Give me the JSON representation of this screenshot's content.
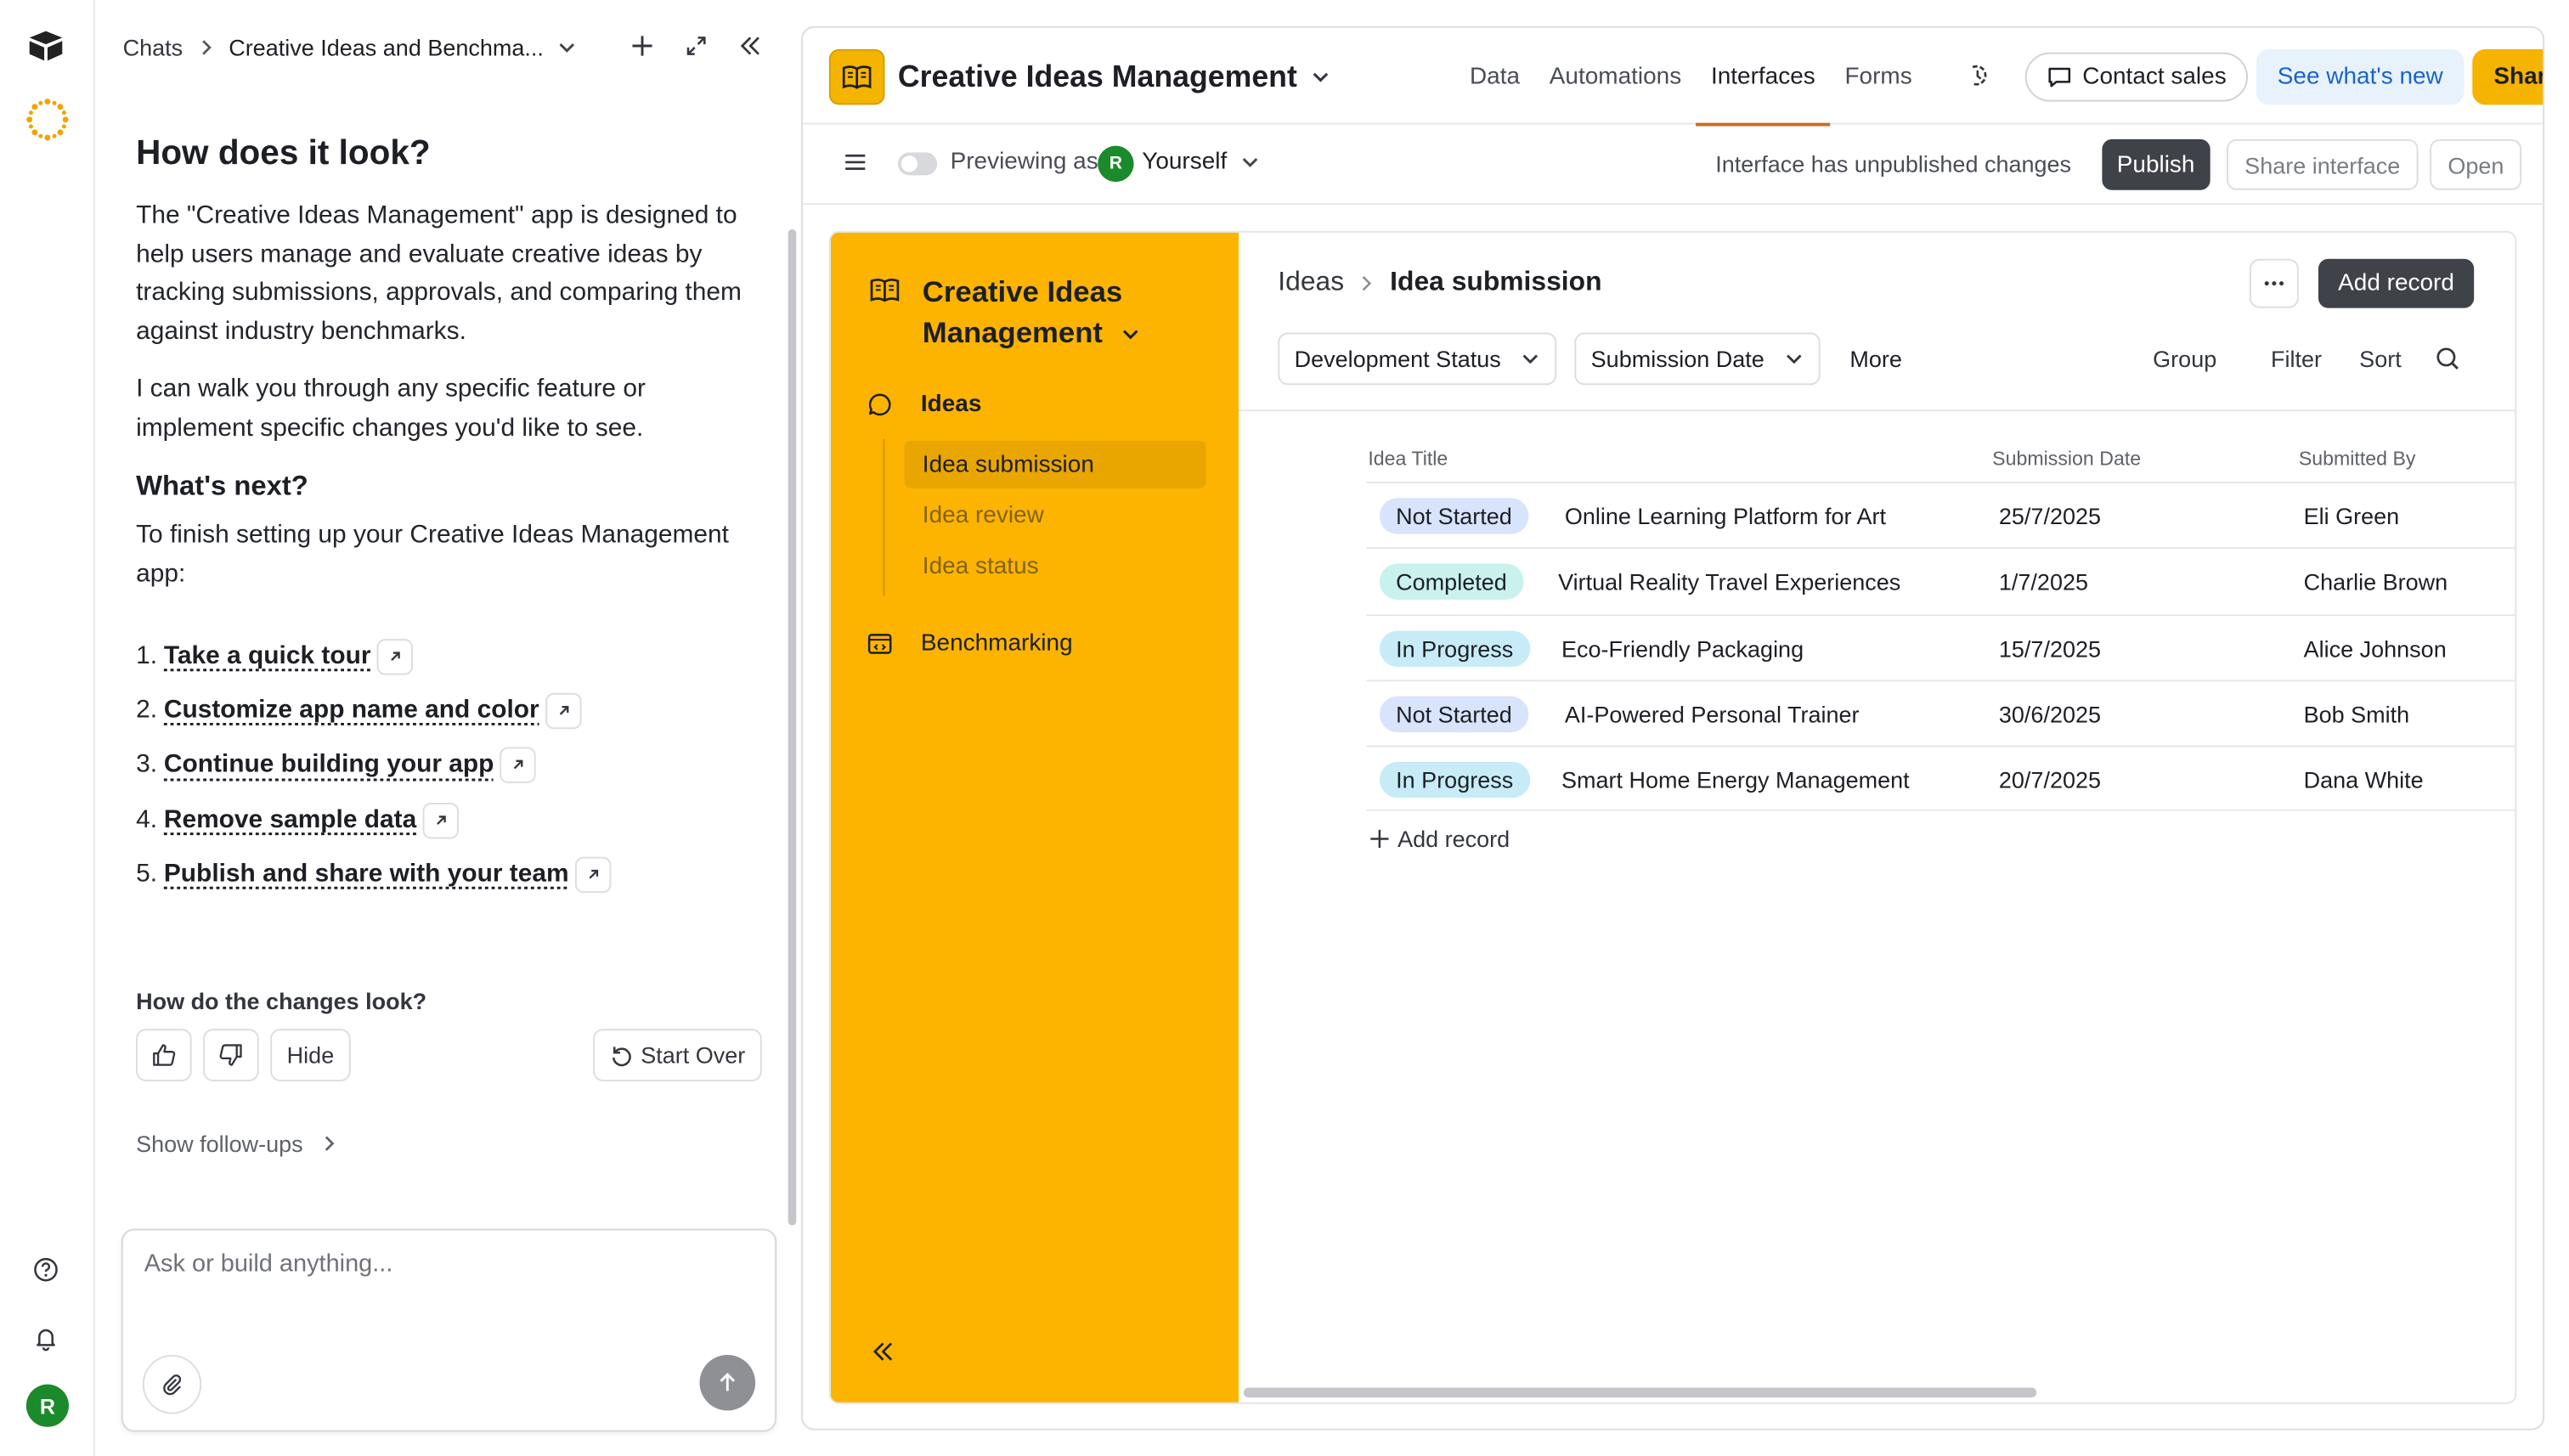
{
  "rail": {
    "avatar_letter": "R"
  },
  "chat": {
    "breadcrumb_root": "Chats",
    "breadcrumb_title": "Creative Ideas and Benchma...",
    "heading": "How does it look?",
    "para1": "The \"Creative Ideas Management\" app is designed to help users manage and evaluate creative ideas by tracking submissions, approvals, and comparing them against industry benchmarks.",
    "para2": "I can walk you through any specific feature or implement specific changes you'd like to see.",
    "next_heading": "What's next?",
    "next_text": "To finish setting up your Creative Ideas Management app:",
    "steps": [
      {
        "num": "1.",
        "label": "Take a quick tour"
      },
      {
        "num": "2.",
        "label": "Customize app name and color"
      },
      {
        "num": "3.",
        "label": "Continue building your app"
      },
      {
        "num": "4.",
        "label": "Remove sample data"
      },
      {
        "num": "5.",
        "label": "Publish and share with your team"
      }
    ],
    "feedback_question": "How do the changes look?",
    "hide_label": "Hide",
    "start_over_label": "Start Over",
    "follow_ups_label": "Show follow-ups",
    "composer_placeholder": "Ask or build anything..."
  },
  "topbar": {
    "app_title": "Creative Ideas Management",
    "tabs": [
      "Data",
      "Automations",
      "Interfaces",
      "Forms"
    ],
    "active_tab": "Interfaces",
    "contact_sales": "Contact sales",
    "whats_new": "See what's new",
    "share": "Share"
  },
  "subbar": {
    "previewing_as": "Previewing as",
    "user_letter": "R",
    "user_name": "Yourself",
    "status_text": "Interface has unpublished changes",
    "publish": "Publish",
    "share_interface": "Share interface",
    "open": "Open"
  },
  "sidebar": {
    "title": "Creative Ideas Management",
    "section_ideas": "Ideas",
    "sub_items": [
      "Idea submission",
      "Idea review",
      "Idea status"
    ],
    "section_bench": "Benchmarking"
  },
  "main": {
    "crumb_parent": "Ideas",
    "crumb_current": "Idea submission",
    "add_record": "Add record",
    "filter1": "Development Status",
    "filter2": "Submission Date",
    "more": "More",
    "group": "Group",
    "filter": "Filter",
    "sort": "Sort",
    "columns": [
      "Idea Title",
      "Submission Date",
      "Submitted By"
    ],
    "rows": [
      {
        "status": "Not Started",
        "status_kind": "ns",
        "title": "Online Learning Platform for Art",
        "date": "25/7/2025",
        "by": "Eli Green"
      },
      {
        "status": "Completed",
        "status_kind": "cp",
        "title": "Virtual Reality Travel Experiences",
        "date": "1/7/2025",
        "by": "Charlie Brown"
      },
      {
        "status": "In Progress",
        "status_kind": "ip",
        "title": "Eco-Friendly Packaging",
        "date": "15/7/2025",
        "by": "Alice Johnson"
      },
      {
        "status": "Not Started",
        "status_kind": "ns",
        "title": "AI-Powered Personal Trainer",
        "date": "30/6/2025",
        "by": "Bob Smith"
      },
      {
        "status": "In Progress",
        "status_kind": "ip",
        "title": "Smart Home Energy Management",
        "date": "20/7/2025",
        "by": "Dana White"
      }
    ],
    "add_record_row": "Add record"
  },
  "colors": {
    "accent_yellow": "#fcb400",
    "tab_underline": "#c86d24",
    "avatar_green": "#1a8a2b",
    "link_blue": "#1a63c9"
  }
}
